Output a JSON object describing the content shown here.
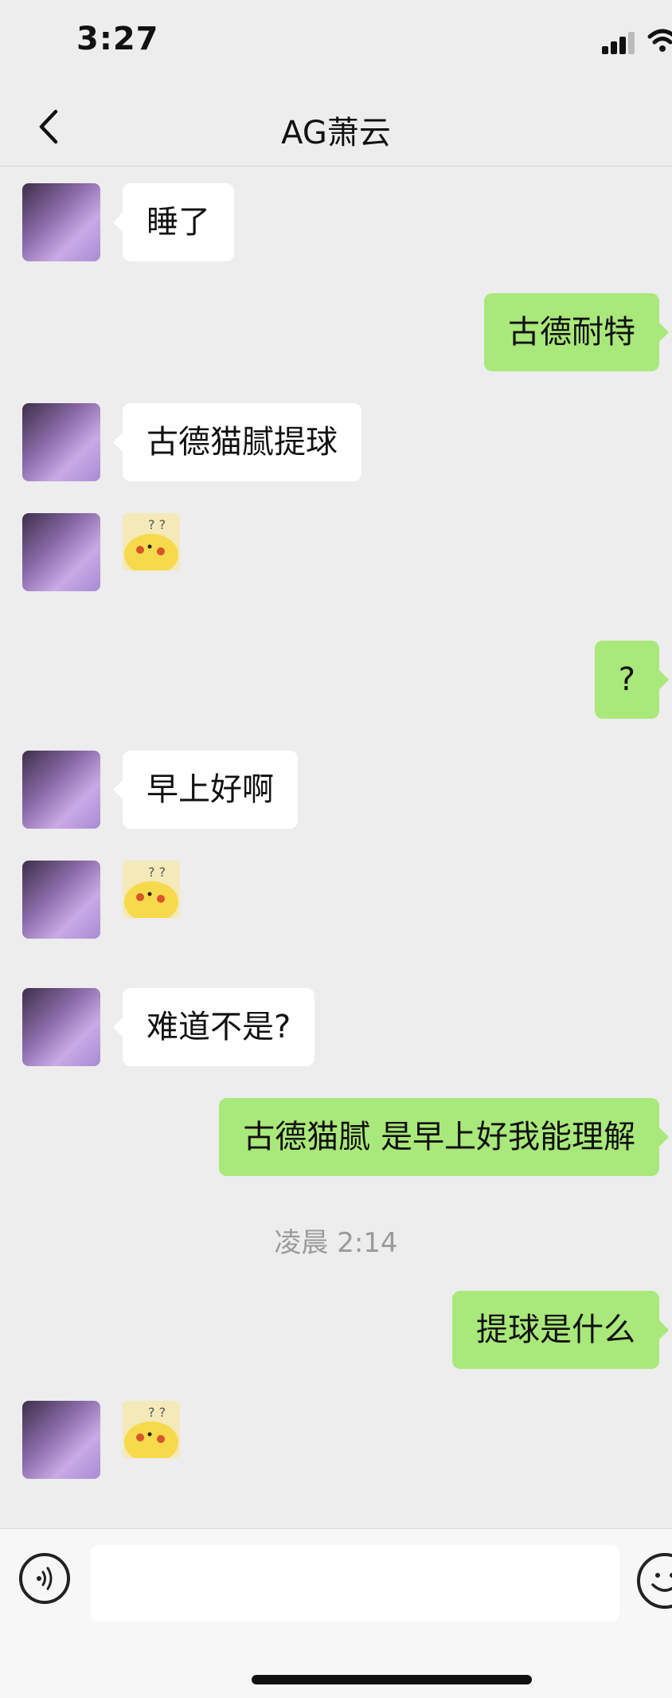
{
  "status_bar": {
    "time": "3:27"
  },
  "header": {
    "title": "AG萧云"
  },
  "messages": {
    "m1": {
      "text": "睡了"
    },
    "m2": {
      "text": "古德耐特"
    },
    "m3": {
      "text": "古德猫腻提球"
    },
    "m5": {
      "text": "?"
    },
    "m6": {
      "text": "早上好啊"
    },
    "m8": {
      "text": "难道不是?"
    },
    "m9": {
      "text": "古德猫腻 是早上好我能理解"
    },
    "timestamp": "凌晨 2:14",
    "m10": {
      "text": "提球是什么"
    }
  },
  "input": {
    "value": ""
  },
  "colors": {
    "background": "#ededed",
    "outgoing_bubble": "#a9e87a",
    "incoming_bubble": "#ffffff"
  }
}
